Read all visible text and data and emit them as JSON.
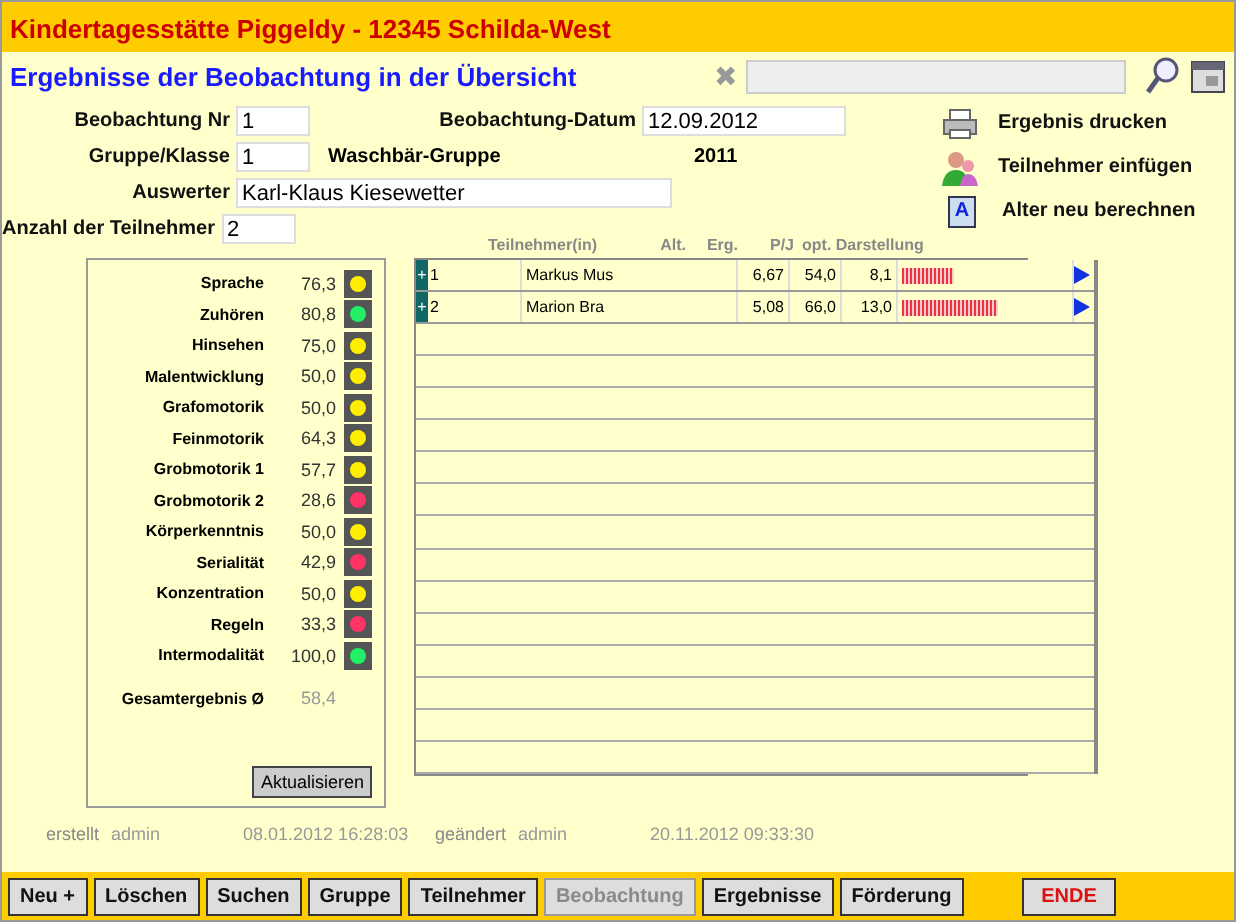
{
  "window": {
    "title": "Kindertagesstätte Piggeldy  - 12345 Schilda-West"
  },
  "heading": "Ergebnisse der Beobachtung in der Übersicht",
  "search": {
    "clear": "✖"
  },
  "form": {
    "nr_label": "Beobachtung Nr",
    "nr": "1",
    "datum_label": "Beobachtung-Datum",
    "datum": "12.09.2012",
    "gruppe_label": "Gruppe/Klasse",
    "gruppe": "1",
    "gruppe_name": "Waschbär-Gruppe",
    "jahr": "2011",
    "auswerter_label": "Auswerter",
    "auswerter": "Karl-Klaus Kiesewetter",
    "anzahl_label": "Anzahl der Teilnehmer",
    "anzahl": "2"
  },
  "actions": [
    {
      "kind": "print",
      "label": "Ergebnis drucken"
    },
    {
      "kind": "person",
      "label": "Teilnehmer einfügen"
    },
    {
      "kind": "letter",
      "label": "Alter neu berechnen",
      "glyph": "A"
    }
  ],
  "areas": [
    {
      "name": "Sprache",
      "value": "76,3",
      "color": "#ffee00"
    },
    {
      "name": "Zuhören",
      "value": "80,8",
      "color": "#22ee66"
    },
    {
      "name": "Hinsehen",
      "value": "75,0",
      "color": "#ffee00"
    },
    {
      "name": "Malentwicklung",
      "value": "50,0",
      "color": "#ffee00"
    },
    {
      "name": "Grafomotorik",
      "value": "50,0",
      "color": "#ffee00"
    },
    {
      "name": "Feinmotorik",
      "value": "64,3",
      "color": "#ffee00"
    },
    {
      "name": "Grobmotorik 1",
      "value": "57,7",
      "color": "#ffee00"
    },
    {
      "name": "Grobmotorik 2",
      "value": "28,6",
      "color": "#ff3366"
    },
    {
      "name": "Körperkenntnis",
      "value": "50,0",
      "color": "#ffee00"
    },
    {
      "name": "Serialität",
      "value": "42,9",
      "color": "#ff3366"
    },
    {
      "name": "Konzentration",
      "value": "50,0",
      "color": "#ffee00"
    },
    {
      "name": "Regeln",
      "value": "33,3",
      "color": "#ff3366"
    },
    {
      "name": "Intermodalität",
      "value": "100,0",
      "color": "#22ee66"
    }
  ],
  "total": {
    "label": "Gesamtergebnis Ø",
    "value": "58,4"
  },
  "refresh_button": "Aktualisieren",
  "table": {
    "columns": [
      "Teilnehmer(in)",
      "Alt.",
      "Erg.",
      "P/J",
      "opt. Darstellung"
    ],
    "rows": [
      {
        "expand": "+",
        "nr": "1",
        "name": "Markus Mus",
        "alt": "6,67",
        "erg": "54,0",
        "pj": "8,1",
        "level": 0.3
      },
      {
        "expand": "+",
        "nr": "2",
        "name": "Marion Bra",
        "alt": "5,08",
        "erg": "66,0",
        "pj": "13,0",
        "level": 0.56
      }
    ]
  },
  "footer": {
    "created_label": "erstellt",
    "created_by": "admin",
    "created_at": "08.01.2012 16:28:03",
    "changed_label": "geändert",
    "changed_by": "admin",
    "changed_at": "20.11.2012 09:33:30"
  },
  "buttons": [
    {
      "label": "Neu +",
      "disabled": false
    },
    {
      "label": "Löschen",
      "disabled": false
    },
    {
      "label": "Suchen",
      "disabled": false
    },
    {
      "label": "Gruppe",
      "disabled": false
    },
    {
      "label": "Teilnehmer",
      "disabled": false
    },
    {
      "label": "Beobachtung",
      "disabled": true
    },
    {
      "label": "Ergebnisse",
      "disabled": false
    },
    {
      "label": "Förderung",
      "disabled": false
    }
  ],
  "exit_button": "ENDE"
}
